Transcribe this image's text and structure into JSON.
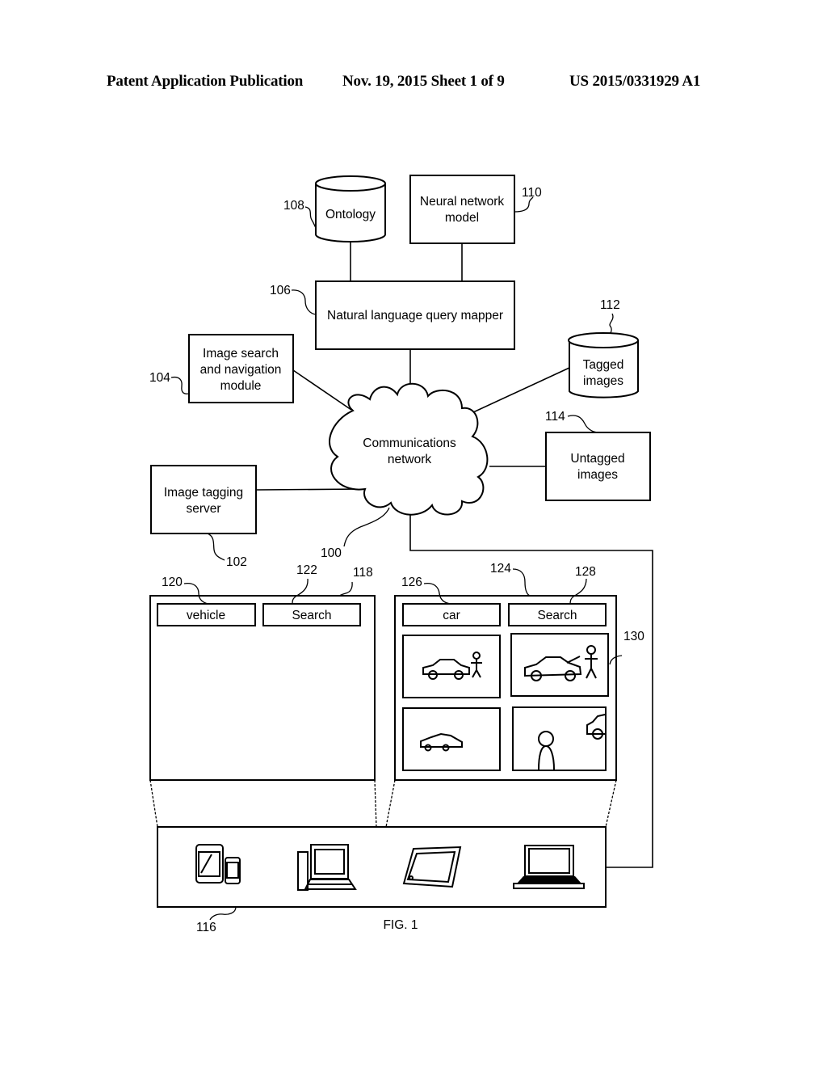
{
  "header": {
    "publication": "Patent Application Publication",
    "date_sheet": "Nov. 19, 2015   Sheet 1 of 9",
    "number": "US 2015/0331929 A1"
  },
  "figure": {
    "caption": "FIG. 1",
    "nodes": {
      "ontology": {
        "label": "Ontology",
        "ref": "108"
      },
      "neural_network": {
        "line1": "Neural network",
        "line2": "model",
        "ref": "110"
      },
      "query_mapper": {
        "label": "Natural language query mapper",
        "ref": "106"
      },
      "search_module": {
        "line1": "Image search",
        "line2": "and navigation",
        "line3": "module",
        "ref": "104"
      },
      "tagged_images": {
        "line1": "Tagged",
        "line2": "images",
        "ref": "112"
      },
      "network": {
        "line1": "Communications",
        "line2": "network",
        "ref": "100"
      },
      "untagged_images": {
        "line1": "Untagged",
        "line2": "images",
        "ref": "114"
      },
      "tagging_server": {
        "line1": "Image tagging",
        "line2": "server",
        "ref": "102"
      },
      "client_devices": {
        "ref": "116",
        "devices": [
          "tablet-and-phone",
          "desktop-computer",
          "tablet",
          "laptop"
        ]
      }
    },
    "screen_left": {
      "ref": "118",
      "query_input": {
        "value": "vehicle",
        "ref": "120"
      },
      "search_button": {
        "label": "Search",
        "ref": "122"
      }
    },
    "screen_right": {
      "ref": "124",
      "query_input": {
        "value": "car",
        "ref": "126"
      },
      "search_button": {
        "label": "Search",
        "ref": "128"
      },
      "results_ref": "130",
      "results": [
        "car-with-person",
        "car-hood-open-with-person",
        "sports-car",
        "person-with-car-edge"
      ]
    }
  }
}
